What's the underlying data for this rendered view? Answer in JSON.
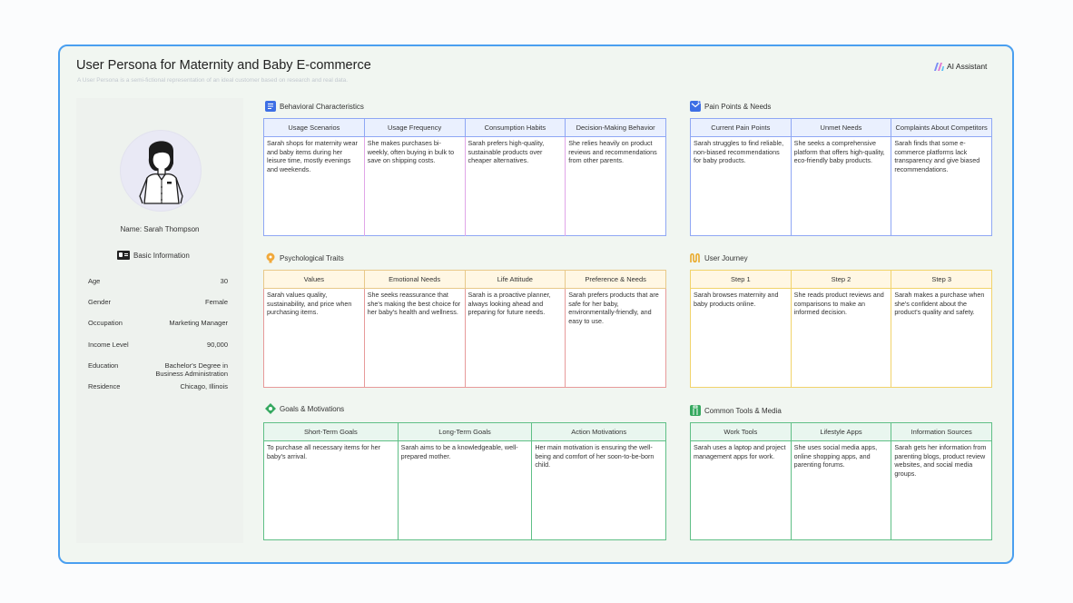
{
  "header": {
    "title": "User Persona for Maternity and Baby E-commerce",
    "subtitle": "A User Persona is a semi-fictional representation of an ideal customer based on research and real data.",
    "ai_label": "AI Assistant"
  },
  "profile": {
    "name_line": "Name: Sarah Thompson",
    "basic_info_label": "Basic Information",
    "fields": [
      {
        "label": "Age",
        "value": "30"
      },
      {
        "label": "Gender",
        "value": "Female"
      },
      {
        "label": "Occupation",
        "value": "Marketing Manager"
      },
      {
        "label": "Income Level",
        "value": "90,000"
      },
      {
        "label": "Education",
        "value": "Bachelor's Degree in Business Administration"
      },
      {
        "label": "Residence",
        "value": "Chicago, Illinois"
      }
    ]
  },
  "sections": {
    "behavioral": {
      "title": "Behavioral Characteristics",
      "icon": "document-icon",
      "color": "#6f8ff0",
      "headers": [
        "Usage Scenarios",
        "Usage Frequency",
        "Consumption Habits",
        "Decision-Making Behavior"
      ],
      "cells": [
        "Sarah shops for maternity wear and baby items during her leisure time, mostly evenings and weekends.",
        "She makes purchases bi-weekly, often buying in bulk to save on shipping costs.",
        "Sarah prefers high-quality, sustainable products over cheaper alternatives.",
        "She relies heavily on product reviews and recommendations from other parents."
      ]
    },
    "pain_points": {
      "title": "Pain Points & Needs",
      "icon": "mail-icon",
      "color": "#6f8ff0",
      "headers": [
        "Current Pain Points",
        "Unmet Needs",
        "Complaints About Competitors"
      ],
      "cells": [
        "Sarah struggles to find reliable, non-biased recommendations for baby products.",
        "She seeks a comprehensive platform that offers high-quality, eco-friendly baby products.",
        "Sarah finds that some e-commerce platforms lack transparency and give biased recommendations."
      ]
    },
    "psychological": {
      "title": "Psychological Traits",
      "icon": "bulb-icon",
      "color": "#e79a9a",
      "headers": [
        "Values",
        "Emotional Needs",
        "Life Attitude",
        "Preference & Needs"
      ],
      "cells": [
        "Sarah values quality, sustainability, and price when purchasing items.",
        "She seeks reassurance that she's making the best choice for her baby's health and wellness.",
        "Sarah is a proactive planner, always looking ahead and preparing for future needs.",
        "Sarah prefers products that are safe for her baby, environmentally-friendly, and easy to use."
      ]
    },
    "journey": {
      "title": "User Journey",
      "icon": "path-icon",
      "color": "#f1d36b",
      "headers": [
        "Step 1",
        "Step 2",
        "Step 3"
      ],
      "cells": [
        "Sarah browses maternity and baby products online.",
        "She reads product reviews and comparisons to make an informed decision.",
        "Sarah makes a purchase when she's confident about the product's quality and safety."
      ]
    },
    "goals": {
      "title": "Goals & Motivations",
      "icon": "target-icon",
      "color": "#5fbf86",
      "headers": [
        "Short-Term Goals",
        "Long-Term Goals",
        "Action Motivations"
      ],
      "cells": [
        "To purchase all necessary items for her baby's arrival.",
        "Sarah aims to be a knowledgeable, well-prepared mother.",
        "Her main motivation is ensuring the well-being and comfort of her soon-to-be-born child."
      ]
    },
    "tools": {
      "title": "Common Tools & Media",
      "icon": "toolbox-icon",
      "color": "#5fbf86",
      "headers": [
        "Work Tools",
        "Lifestyle Apps",
        "Information Sources"
      ],
      "cells": [
        "Sarah uses a laptop and project management apps for work.",
        "She uses social media apps, online shopping apps, and parenting forums.",
        "Sarah gets her information from parenting blogs, product review websites, and social media groups."
      ]
    }
  }
}
